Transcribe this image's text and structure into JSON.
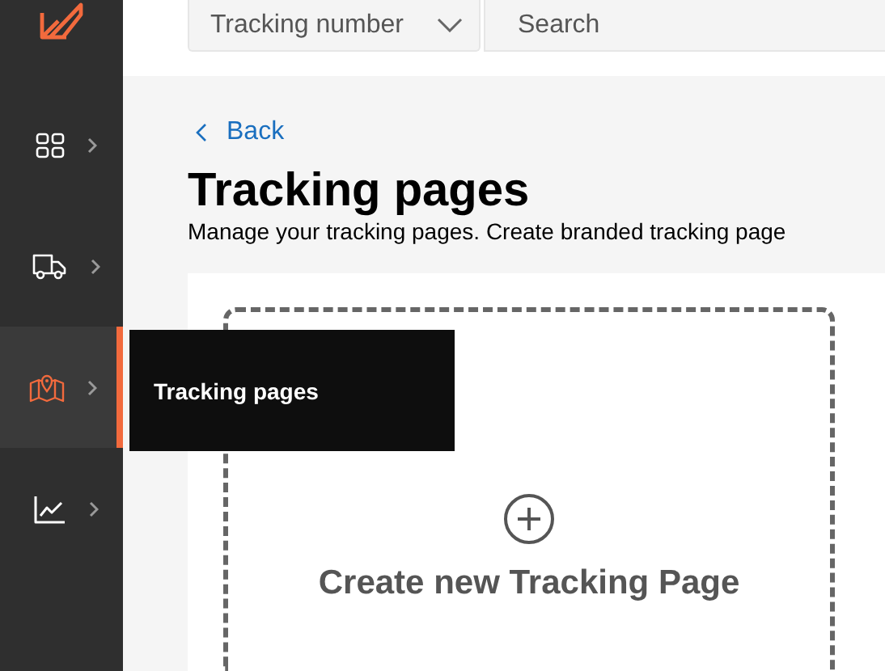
{
  "search_bar": {
    "type_select": "Tracking number",
    "placeholder": "Search"
  },
  "sidebar": {
    "items": [
      {
        "kind": "grid",
        "selected": false
      },
      {
        "kind": "truck",
        "selected": false
      },
      {
        "kind": "map",
        "selected": true
      },
      {
        "kind": "chart",
        "selected": false
      }
    ]
  },
  "flyout": {
    "label": "Tracking pages"
  },
  "back_link": "Back",
  "title": "Tracking pages",
  "subtitle": "Manage your tracking pages. Create branded tracking page",
  "create_card": {
    "label": "Create new Tracking Page"
  }
}
